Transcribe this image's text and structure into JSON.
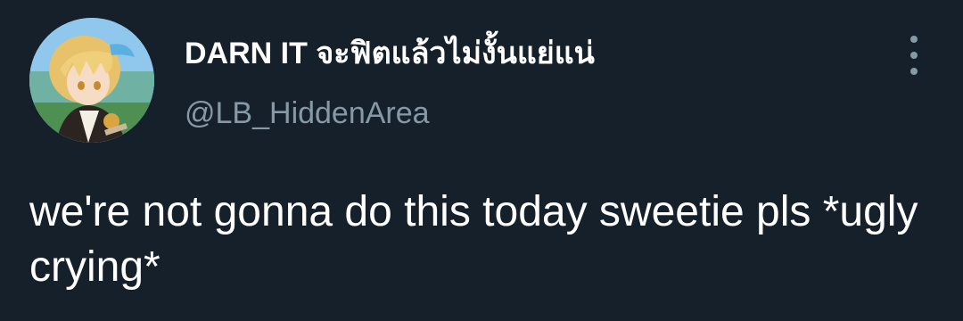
{
  "tweet": {
    "display_name": "DARN IT จะฟิตแล้วไม่งั้นแย่แน่",
    "handle": "@LB_HiddenArea",
    "text": "we're not gonna do this today sweetie pls *ugly crying*",
    "avatar_icon": "anime-character-avatar",
    "more_icon": "vertical-ellipsis-icon"
  },
  "theme": {
    "background": "#15202b",
    "primary_text": "#ffffff",
    "secondary_text": "#8899a6"
  }
}
